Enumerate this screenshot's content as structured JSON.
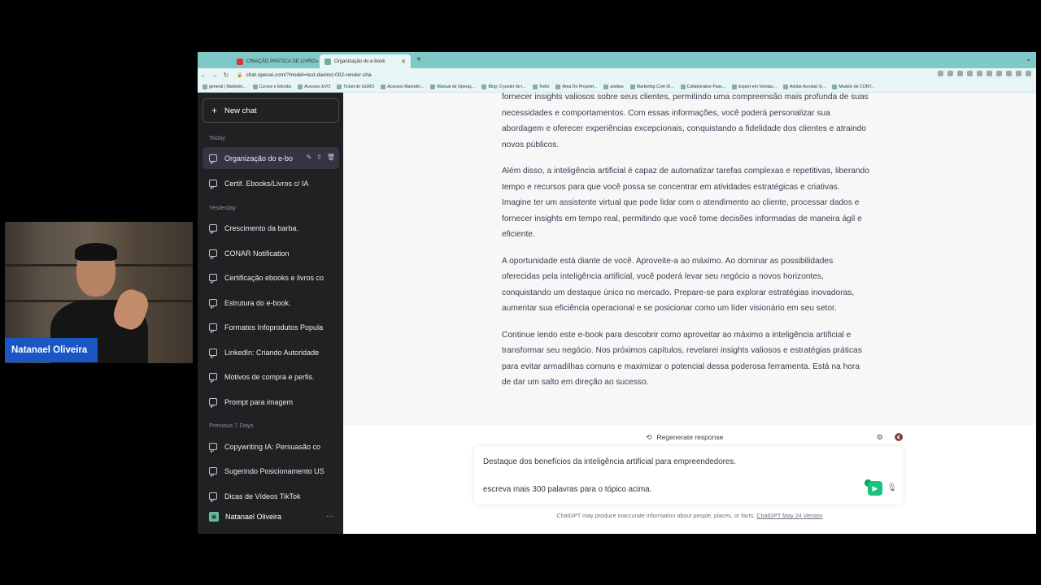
{
  "browser": {
    "tabs": [
      {
        "label": "CRIAÇÃO PRÁTICA DE LIVRO",
        "active": false,
        "color": "#d33a3a"
      },
      {
        "label": "Organização do e-book",
        "active": true,
        "color": "#74aa9c"
      }
    ],
    "new_tab": "+",
    "url": "chat.openai.com/?model=text-davinci-002-render-sha",
    "bookmarks": [
      "general | Marketin...",
      "Cursos e Ebooks",
      "Acessos EVO",
      "Ticket do GURO",
      "Acessos Marketin...",
      "Manual de Operaç...",
      "Blog: O poder do l...",
      "Trello",
      "Área Do Propriet...",
      "anelias",
      "Marketing Com Di...",
      "Collaborative Pass...",
      "Expert em Vendas...",
      "Adobe Acrobat Xi...",
      "Modelo de CONT..."
    ]
  },
  "sidebar": {
    "new_chat": "New chat",
    "sections": {
      "today": "Today",
      "yesterday": "Yesterday",
      "previous7": "Previous 7 Days"
    },
    "items": [
      "Organização do e-bo",
      "Certif. Ebooks/Livros c/ IA",
      "Crescimento da barba.",
      "CONAR Notification",
      "Certificação ebooks e livros co",
      "Estrutura do e-book.",
      "Formatos Infoprodutos Popula",
      "LinkedIn: Criando Autoridade",
      "Motivos de compra e perfis.",
      "Prompt para imagem",
      "Copywriting IA: Persuasão co",
      "Sugerindo Posicionamento US",
      "Dicas de Vídeos TikTok"
    ],
    "user_name": "Natanael Oliveira"
  },
  "content": {
    "paragraphs": [
      "fornecer insights valiosos sobre seus clientes, permitindo uma compreensão mais profunda de suas necessidades e comportamentos. Com essas informações, você poderá personalizar sua abordagem e oferecer experiências excepcionais, conquistando a fidelidade dos clientes e atraindo novos públicos.",
      "Além disso, a inteligência artificial é capaz de automatizar tarefas complexas e repetitivas, liberando tempo e recursos para que você possa se concentrar em atividades estratégicas e criativas. Imagine ter um assistente virtual que pode lidar com o atendimento ao cliente, processar dados e fornecer insights em tempo real, permitindo que você tome decisões informadas de maneira ágil e eficiente.",
      "A oportunidade está diante de você. Aproveite-a ao máximo. Ao dominar as possibilidades oferecidas pela inteligência artificial, você poderá levar seu negócio a novos horizontes, conquistando um destaque único no mercado. Prepare-se para explorar estratégias inovadoras, aumentar sua eficiência operacional e se posicionar como um líder visionário em seu setor.",
      "Continue lendo este e-book para descobrir como aproveitar ao máximo a inteligência artificial e transformar seu negócio. Nos próximos capítulos, revelarei insights valiosos e estratégias práticas para evitar armadilhas comuns e maximizar o potencial dessa poderosa ferramenta. Está na hora de dar um salto em direção ao sucesso."
    ]
  },
  "composer": {
    "regenerate": "Regenerate response",
    "line1": "Destaque dos benefícios da inteligência artificial para empreendedores.",
    "line2": "escreva mais 300 palavras para o tópico acima.",
    "disclaimer": "ChatGPT may produce inaccurate information about people, places, or facts.",
    "version_link": "ChatGPT May 24 Version"
  },
  "webcam": {
    "name": "Natanael Oliveira"
  }
}
